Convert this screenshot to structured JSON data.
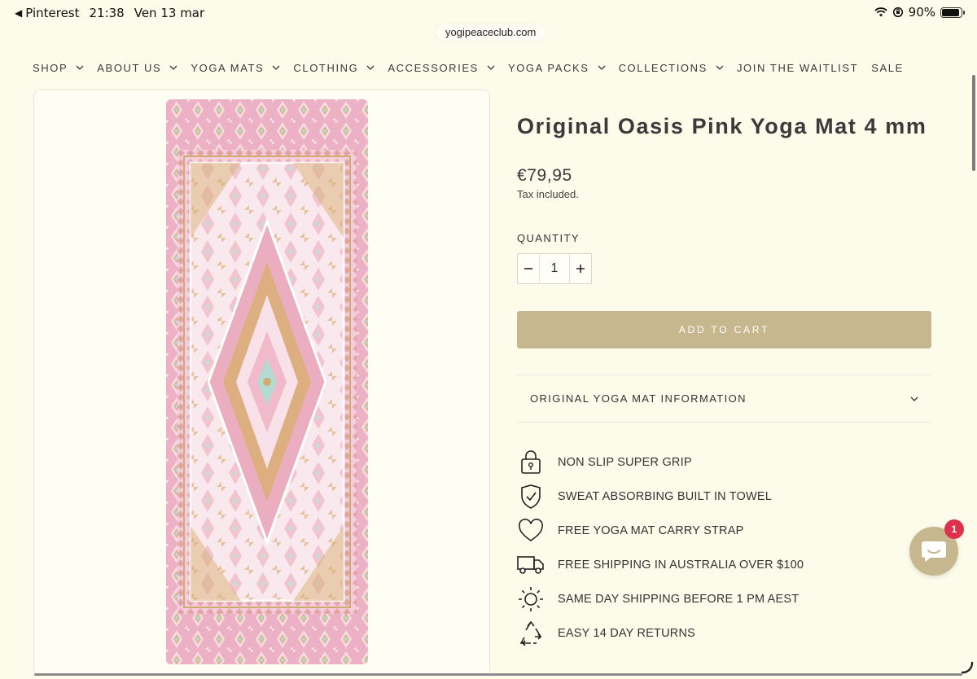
{
  "status_bar": {
    "back_app": "Pinterest",
    "time": "21:38",
    "date": "Ven 13 mar",
    "battery": "90%",
    "battery_level": 0.9
  },
  "browser": {
    "url": "yogipeaceclub.com"
  },
  "nav": {
    "items": [
      {
        "label": "SHOP",
        "has_dropdown": true
      },
      {
        "label": "ABOUT US",
        "has_dropdown": true
      },
      {
        "label": "YOGA MATS",
        "has_dropdown": true
      },
      {
        "label": "CLOTHING",
        "has_dropdown": true
      },
      {
        "label": "ACCESSORIES",
        "has_dropdown": true
      },
      {
        "label": "YOGA PACKS",
        "has_dropdown": true
      },
      {
        "label": "COLLECTIONS",
        "has_dropdown": true
      },
      {
        "label": "JOIN THE WAITLIST",
        "has_dropdown": false
      },
      {
        "label": "SALE",
        "has_dropdown": false
      }
    ]
  },
  "product": {
    "title": "Original Oasis Pink Yoga Mat 4 mm",
    "price": "€79,95",
    "tax_note": "Tax included.",
    "quantity_label": "QUANTITY",
    "quantity_value": "1",
    "add_to_cart_label": "ADD TO CART",
    "accordion_label": "ORIGINAL YOGA MAT INFORMATION"
  },
  "features": [
    {
      "icon": "lock-icon",
      "label": "NON SLIP SUPER GRIP"
    },
    {
      "icon": "shield-check-icon",
      "label": "SWEAT ABSORBING BUILT IN TOWEL"
    },
    {
      "icon": "heart-icon",
      "label": "FREE YOGA MAT CARRY STRAP"
    },
    {
      "icon": "truck-icon",
      "label": "FREE SHIPPING IN AUSTRALIA OVER $100"
    },
    {
      "icon": "sun-icon",
      "label": "SAME DAY SHIPPING BEFORE 1 PM AEST"
    },
    {
      "icon": "recycle-icon",
      "label": "EASY 14 DAY RETURNS"
    }
  ],
  "chat": {
    "badge_count": "1"
  },
  "colors": {
    "background": "#fdfbea",
    "accent": "#c7b78f",
    "badge": "#e0304b",
    "mat_pink": "#eaa7bd",
    "mat_gold": "#c9a05a"
  }
}
